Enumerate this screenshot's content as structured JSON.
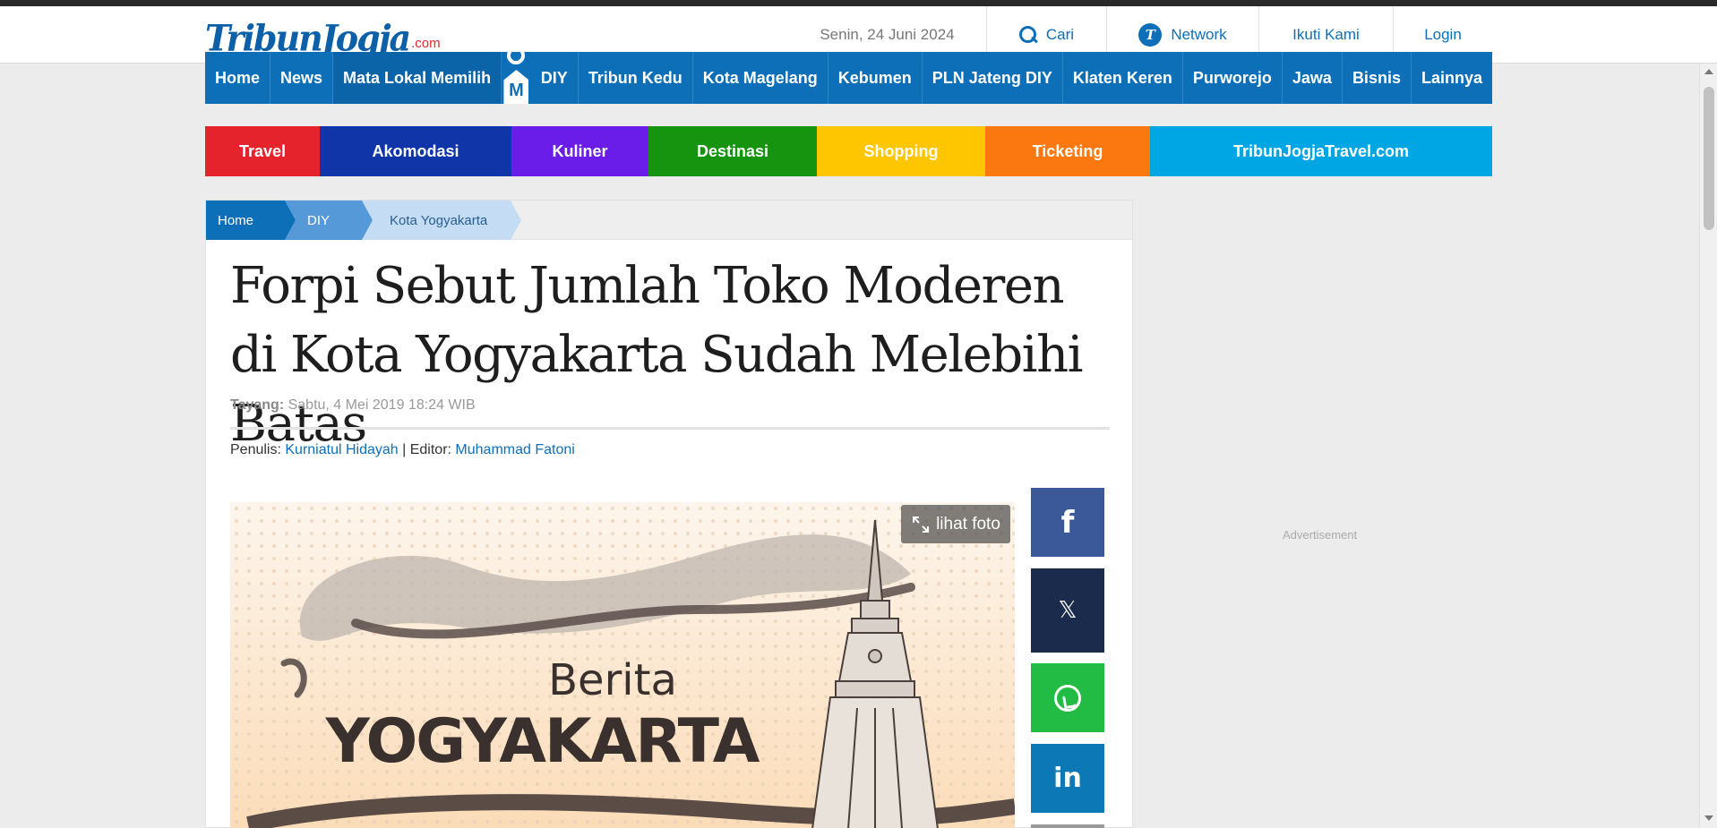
{
  "header": {
    "logo_main": "TribunJogja",
    "logo_suffix": ".com",
    "date": "Senin, 24 Juni 2024",
    "search_label": "Cari",
    "network_label": "Network",
    "network_icon_letter": "T",
    "follow_label": "Ikuti Kami",
    "login_label": "Login"
  },
  "mainnav": {
    "items": [
      "Home",
      "News",
      "Mata Lokal Memilih",
      "DIY",
      "Tribun Kedu",
      "Kota Magelang",
      "Kebumen",
      "PLN Jateng DIY",
      "Klaten Keren",
      "Purworejo",
      "Jawa",
      "Bisnis",
      "Lainnya"
    ],
    "mascot_letter": "M"
  },
  "catnav": {
    "items": [
      {
        "label": "Travel",
        "color": "#e5232d"
      },
      {
        "label": "Akomodasi",
        "color": "#0f35a8"
      },
      {
        "label": "Kuliner",
        "color": "#6a1ce8"
      },
      {
        "label": "Destinasi",
        "color": "#16940f"
      },
      {
        "label": "Shopping",
        "color": "#fdc600"
      },
      {
        "label": "Ticketing",
        "color": "#fb7710"
      },
      {
        "label": "TribunJogjaTravel.com",
        "color": "#00a6e3"
      }
    ]
  },
  "breadcrumb": {
    "home": "Home",
    "diy": "DIY",
    "kota": "Kota Yogyakarta"
  },
  "article": {
    "title": "Forpi Sebut Jumlah Toko Moderen di Kota Yogyakarta Sudah Melebihi Batas",
    "published_label": "Tayang:",
    "published_value": " Sabtu, 4 Mei 2019 18:24 WIB",
    "writer_label": "Penulis:",
    "writer_name": "Kurniatul Hidayah",
    "divider": " | ",
    "editor_label": "Editor:",
    "editor_name": "Muhammad Fatoni",
    "photo_button": "lihat foto",
    "photo_text_small": "Berita",
    "photo_text_large": "YOGYAKARTA"
  },
  "share": {
    "facebook_glyph": "f",
    "x_glyph": "𝕏",
    "linkedin_glyph": "in"
  },
  "sidebar": {
    "ad_label": "Advertisement"
  }
}
